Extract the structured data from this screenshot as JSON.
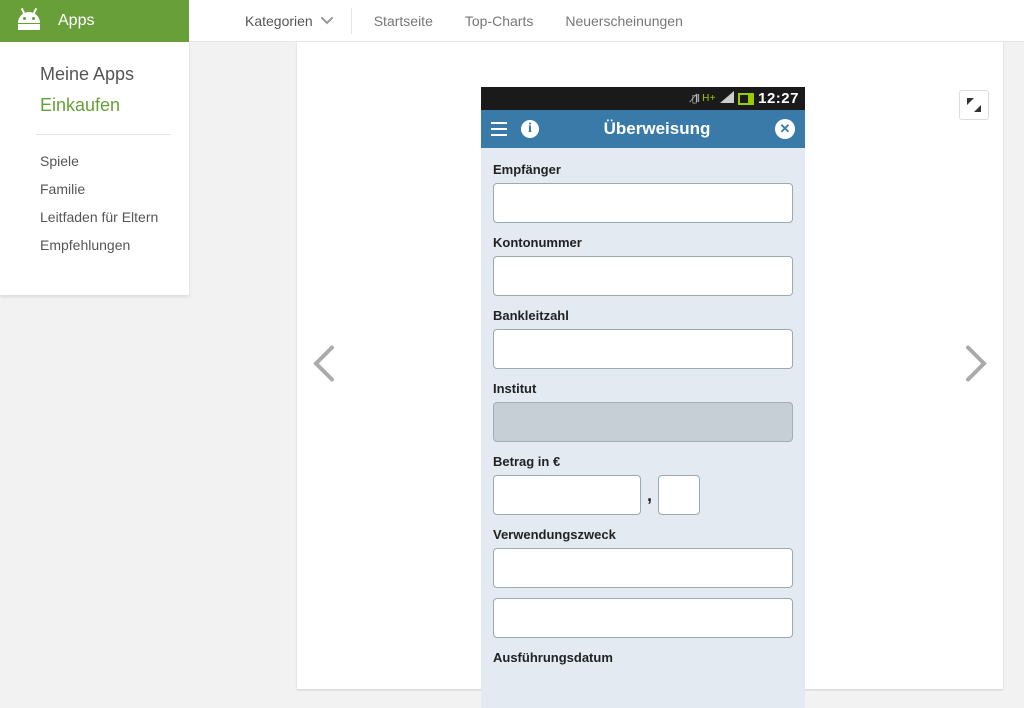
{
  "header": {
    "brand": "Apps",
    "categories_label": "Kategorien",
    "nav": [
      "Startseite",
      "Top-Charts",
      "Neuerscheinungen"
    ]
  },
  "sidebar": {
    "my_apps": "Meine Apps",
    "shop": "Einkaufen",
    "links": [
      "Spiele",
      "Familie",
      "Leitfaden für Eltern",
      "Empfehlungen"
    ]
  },
  "phone": {
    "status_time": "12:27",
    "appbar_title": "Überweisung",
    "info_glyph": "i",
    "close_glyph": "✕",
    "form": {
      "recipient_label": "Empfänger",
      "account_label": "Kontonummer",
      "bankcode_label": "Bankleitzahl",
      "bank_label": "Institut",
      "amount_label": "Betrag in €",
      "amount_separator": ",",
      "purpose_label": "Verwendungszweck",
      "date_label": "Ausführungsdatum"
    }
  },
  "icons": {
    "signal_hplus": "H+",
    "mute": "◁×"
  }
}
